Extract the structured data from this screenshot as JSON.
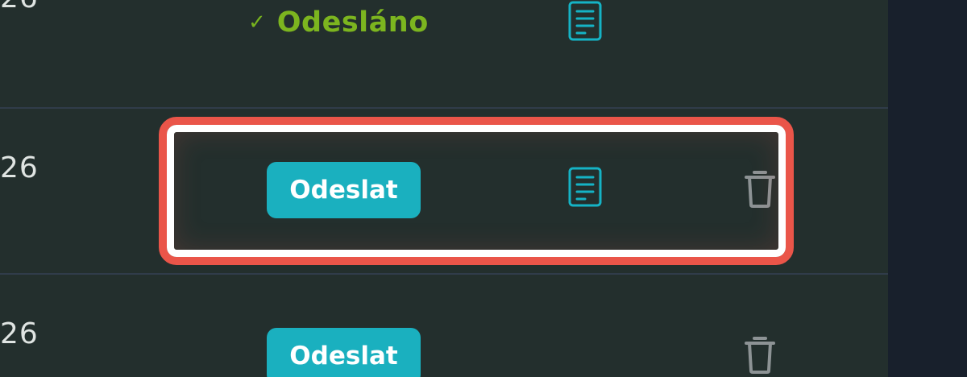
{
  "rows": [
    {
      "date_fragment": "26",
      "status": {
        "type": "sent",
        "check_icon": "check-icon",
        "label": "Odesláno",
        "color": "#7cb51f"
      },
      "document_icon": "document-icon"
    },
    {
      "date_fragment": "26",
      "action_label": "Odeslat",
      "document_icon": "document-icon",
      "delete_icon": "trash-icon",
      "highlighted": true
    },
    {
      "date_fragment": "26",
      "action_label": "Odeslat",
      "delete_icon": "trash-icon"
    }
  ],
  "colors": {
    "table_background": "#232f2d",
    "sidebar_background": "#18202c",
    "divider": "#303c4a",
    "button_teal": "#1ab0bf",
    "document_icon": "#15b3c5",
    "trash_icon": "#8d9395",
    "highlight_outer": "#ea5549",
    "highlight_inner": "#ffffff"
  }
}
